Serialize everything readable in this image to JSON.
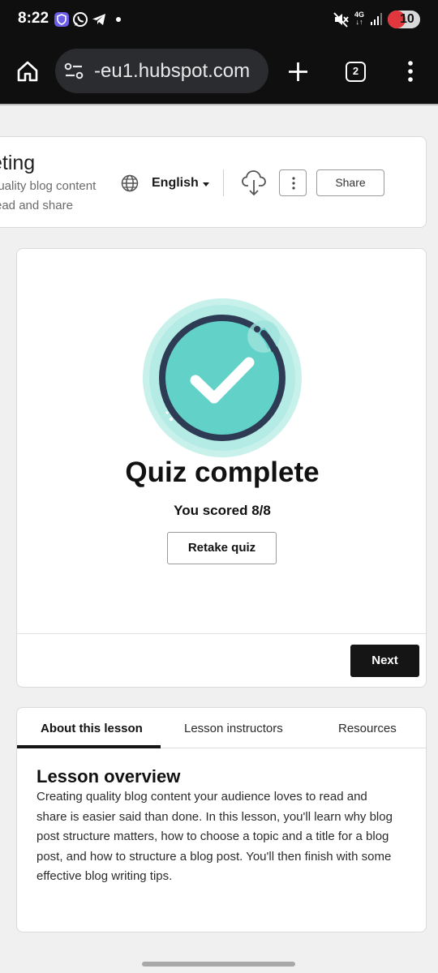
{
  "status_bar": {
    "time": "8:22",
    "network": "4G",
    "battery": "10"
  },
  "browser": {
    "url": "-eu1.hubspot.com",
    "tab_count": "2"
  },
  "lesson_header": {
    "title_partial": "eting",
    "subtitle_line1": "quality blog content",
    "subtitle_line2": "read and share",
    "language": "English",
    "share_label": "Share"
  },
  "quiz": {
    "title": "Quiz complete",
    "score_text": "You scored 8/8",
    "retake_label": "Retake quiz",
    "next_label": "Next"
  },
  "lesson_tabs": [
    {
      "label": "About this lesson",
      "active": true
    },
    {
      "label": "Lesson instructors",
      "active": false
    },
    {
      "label": "Resources",
      "active": false
    }
  ],
  "overview": {
    "title": "Lesson overview",
    "lines": [
      "Creating quality blog content your audience loves to read and",
      "share is easier said than done. In this lesson, you'll learn why blog",
      "post structure matters, how to choose a topic and a title for a blog",
      "post, and how to structure a blog post. You'll then finish with some",
      "effective blog writing tips."
    ]
  },
  "colors": {
    "accent_teal": "#62d2c8",
    "dark_ring": "#2d3b54",
    "button_dark": "#151515"
  }
}
